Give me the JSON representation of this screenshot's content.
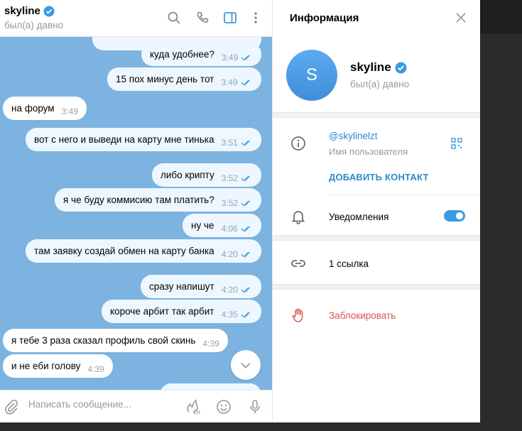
{
  "chat": {
    "name": "skyline",
    "status": "был(а) давно",
    "placeholder": "Написать сообщение...",
    "fire_badge": "2н",
    "messages": [
      {
        "dir": "out",
        "text": "куда удобнее?",
        "time": "3:49"
      },
      {
        "dir": "out",
        "text": "15 пох минус день тот",
        "time": "3:49"
      },
      {
        "dir": "in",
        "text": "на форум",
        "time": "3:49"
      },
      {
        "dir": "out",
        "text": "вот с него и выведи на карту мне тинька",
        "time": "3:51"
      },
      {
        "dir": "out",
        "text": "либо крипту",
        "time": "3:52"
      },
      {
        "dir": "out",
        "text": "я че буду коммисию там платить?",
        "time": "3:52"
      },
      {
        "dir": "out",
        "text": "ну че",
        "time": "4:06"
      },
      {
        "dir": "out",
        "text": "там заявку создай обмен на карту банка",
        "time": "4:20"
      },
      {
        "dir": "out",
        "text": "сразу напишут",
        "time": "4:20"
      },
      {
        "dir": "out",
        "text": "короче арбит так арбит",
        "time": "4:35"
      },
      {
        "dir": "in",
        "text": "я тебе 3 раза сказал профиль свой скинь",
        "time": "4:39"
      },
      {
        "dir": "in",
        "text": "и не еби голову",
        "time": "4:39"
      }
    ]
  },
  "info": {
    "title": "Информация",
    "avatar_letter": "S",
    "name": "skyline",
    "status": "был(а) давно",
    "username": "@skylinelzt",
    "username_label": "Имя пользователя",
    "add_contact": "ДОБАВИТЬ КОНТАКТ",
    "notifications": "Уведомления",
    "notifications_on": true,
    "links": "1 ссылка",
    "block": "Заблокировать"
  },
  "colors": {
    "accent": "#3b9be0",
    "chat_bg": "#7cb3e0",
    "danger": "#d9534f"
  }
}
